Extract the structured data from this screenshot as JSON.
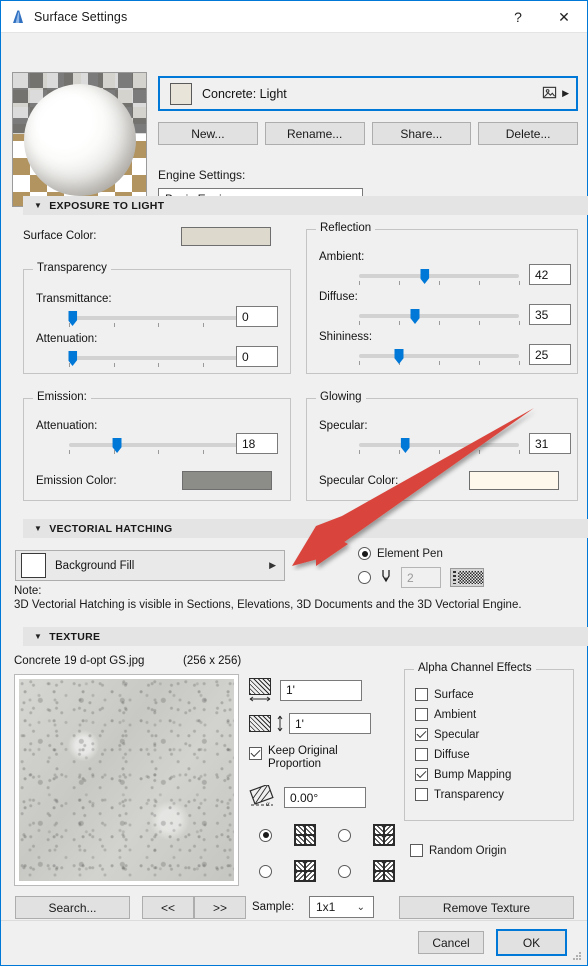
{
  "window": {
    "title": "Surface Settings",
    "app_icon": "archicad-icon",
    "help_button": "?",
    "close_button": "✕"
  },
  "material": {
    "name": "Concrete: Light",
    "swatch_color": "#e8e4da",
    "picker_icon": "image-picker-icon",
    "expand_icon": "chevron-right-icon"
  },
  "toolbar": {
    "new_label": "New...",
    "rename_label": "Rename...",
    "share_label": "Share...",
    "delete_label": "Delete..."
  },
  "engine": {
    "label": "Engine Settings:",
    "value": "Basic Engine",
    "options": [
      "Basic Engine"
    ]
  },
  "exposure": {
    "header": "EXPOSURE TO LIGHT",
    "surface_color_label": "Surface Color:",
    "surface_color": "#ded9cd",
    "transparency": {
      "legend": "Transparency",
      "rows": [
        {
          "label": "Transmittance:",
          "value": "0",
          "pct": 0
        },
        {
          "label": "Attenuation:",
          "value": "0",
          "pct": 0
        }
      ]
    },
    "emission": {
      "legend": "Emission:",
      "rows": [
        {
          "label": "Attenuation:",
          "value": "18",
          "pct": 18
        }
      ],
      "color_label": "Emission Color:",
      "color": "#8c8c88"
    },
    "reflection": {
      "legend": "Reflection",
      "rows": [
        {
          "label": "Ambient:",
          "value": "42",
          "pct": 42
        },
        {
          "label": "Diffuse:",
          "value": "35",
          "pct": 35
        },
        {
          "label": "Shininess:",
          "value": "25",
          "pct": 25
        }
      ]
    },
    "glowing": {
      "legend": "Glowing",
      "rows": [
        {
          "label": "Specular:",
          "value": "31",
          "pct": 31
        }
      ],
      "color_label": "Specular Color:",
      "color": "#fdf8eb"
    }
  },
  "hatching": {
    "header": "VECTORIAL HATCHING",
    "background_fill_label": "Background Fill",
    "background_fill_color": "#ffffff",
    "expand_icon": "chevron-right-icon",
    "element_pen_label": "Element Pen",
    "element_pen_selected": true,
    "custom_pen_selected": false,
    "pen_number": "2",
    "note_title": "Note:",
    "note_text": "3D Vectorial Hatching is visible in Sections, Elevations, 3D Documents and the 3D Vectorial Engine."
  },
  "texture": {
    "header": "TEXTURE",
    "filename": "Concrete 19 d-opt GS.jpg",
    "dimensions": "(256 x 256)",
    "width_value": "1'",
    "height_value": "1'",
    "keep_proportion_label": "Keep Original Proportion",
    "keep_proportion_checked": true,
    "angle_value": "0.00°",
    "width_icon": "texture-width-icon",
    "height_icon": "texture-height-icon",
    "angle_icon": "texture-angle-icon",
    "mirror_options": [
      {
        "icon": "mirror-none-icon",
        "selected": true
      },
      {
        "icon": "mirror-horizontal-icon",
        "selected": false
      },
      {
        "icon": "mirror-vertical-icon",
        "selected": false
      },
      {
        "icon": "mirror-both-icon",
        "selected": false
      }
    ],
    "alpha": {
      "legend": "Alpha Channel Effects",
      "items": [
        {
          "label": "Surface",
          "checked": false
        },
        {
          "label": "Ambient",
          "checked": false
        },
        {
          "label": "Specular",
          "checked": true
        },
        {
          "label": "Diffuse",
          "checked": false
        },
        {
          "label": "Bump Mapping",
          "checked": true
        },
        {
          "label": "Transparency",
          "checked": false
        }
      ]
    },
    "random_origin_label": "Random Origin",
    "random_origin_checked": false,
    "search_label": "Search...",
    "prev_label": "<<",
    "next_label": ">>",
    "sample_label": "Sample:",
    "sample_value": "1x1",
    "remove_texture_label": "Remove Texture"
  },
  "footer": {
    "cancel_label": "Cancel",
    "ok_label": "OK"
  },
  "annotation": {
    "arrow_color": "#d9453c"
  }
}
